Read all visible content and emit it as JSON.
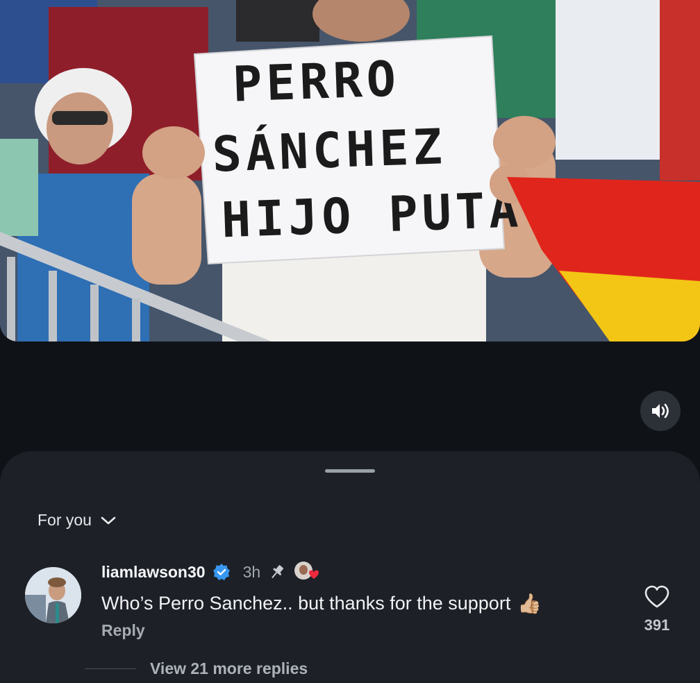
{
  "video": {
    "sign_lines": [
      "PERRO",
      "SÁNCHEZ",
      "HIJO PUTA"
    ],
    "mute_icon": "speaker-volume-icon"
  },
  "comments": {
    "filter_label": "For you",
    "filter_icon": "chevron-down-icon",
    "comment": {
      "username": "liamlawson30",
      "verified_icon": "verified-badge-icon",
      "time": "3h",
      "pinned_icon": "pin-icon",
      "liked_by_creator_icon": "creator-heart-icon",
      "text": "Who’s Perro Sanchez.. but thanks for the support",
      "emoji": "👍🏼",
      "reply_label": "Reply",
      "likes": "391"
    },
    "view_more_label": "View 21 more replies"
  },
  "colors": {
    "background": "#0f1217",
    "sheet": "#1d2127",
    "verified": "#3897f0",
    "flag_red": "#e0261c",
    "flag_yellow": "#f3c515"
  }
}
